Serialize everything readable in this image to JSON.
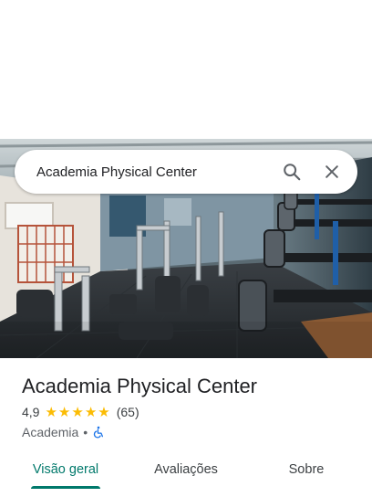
{
  "search": {
    "query": "Academia Physical Center"
  },
  "place": {
    "name": "Academia Physical Center",
    "rating": "4,9",
    "stars_count": 5,
    "reviews": "(65)",
    "category": "Academia",
    "separator": "•"
  },
  "tabs": [
    {
      "label": "Visão geral",
      "active": true
    },
    {
      "label": "Avaliações",
      "active": false
    },
    {
      "label": "Sobre",
      "active": false
    }
  ],
  "colors": {
    "accent": "#00796b",
    "star": "#fbbc04",
    "accessibility": "#1a73e8"
  },
  "icons": {
    "search": "search-icon",
    "close": "close-icon",
    "accessibility": "wheelchair-icon"
  }
}
